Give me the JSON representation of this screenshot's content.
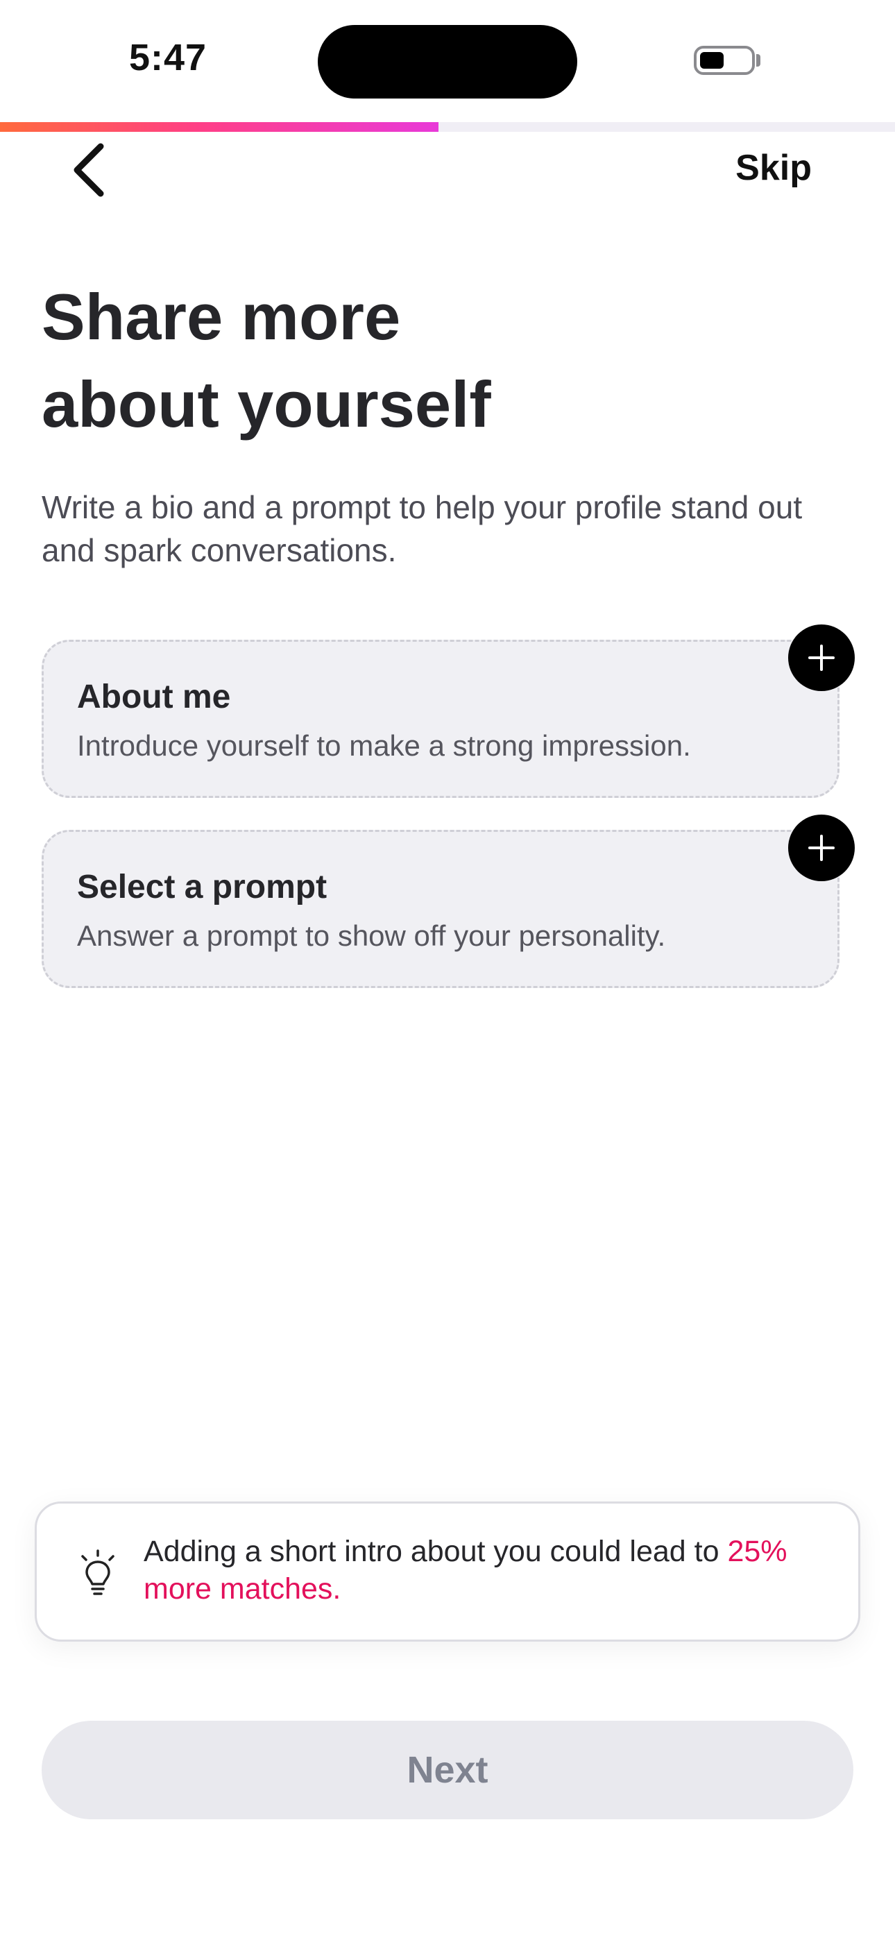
{
  "status_bar": {
    "time": "5:47"
  },
  "progress": {
    "fraction": 0.49
  },
  "nav": {
    "skip_label": "Skip"
  },
  "header": {
    "title_line1": "Share more",
    "title_line2": "about yourself",
    "subtitle": "Write a bio and a prompt to help your profile stand out and spark conversations."
  },
  "cards": [
    {
      "title": "About me",
      "description": "Introduce yourself to make a strong impression."
    },
    {
      "title": "Select a prompt",
      "description": "Answer a prompt to show off your personality."
    }
  ],
  "tip": {
    "text": "Adding a short intro about you could lead to ",
    "highlight": "25% more matches.",
    "highlight_color": "#e3105b"
  },
  "footer": {
    "next_label": "Next"
  },
  "colors": {
    "progress_start": "#ff6a3d",
    "progress_end": "#e83ad8",
    "card_bg": "#f0f0f4",
    "next_disabled_bg": "#e9e9ee"
  }
}
